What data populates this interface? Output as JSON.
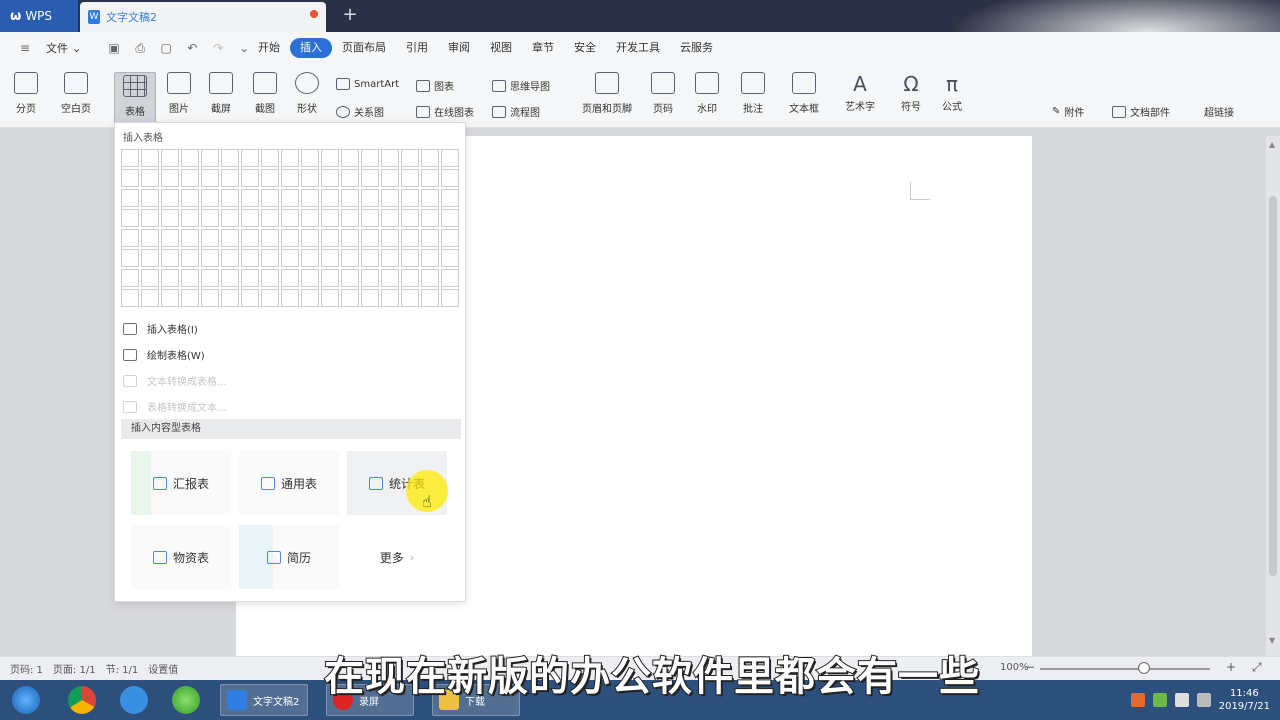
{
  "titlebar": {
    "app_name": "WPS",
    "doc_tab": "文字文稿2",
    "add_tab": "+"
  },
  "menubar": {
    "file_label": "文件",
    "items": [
      "开始",
      "插入",
      "页面布局",
      "引用",
      "审阅",
      "视图",
      "章节",
      "安全",
      "开发工具",
      "云服务"
    ],
    "active_index": 1
  },
  "ribbon": {
    "tools": [
      "分页",
      "空白页",
      "表格",
      "图片",
      "截屏",
      "截图",
      "形状",
      "页眉和页脚",
      "页码",
      "水印",
      "批注",
      "文本框",
      "艺术字",
      "符号",
      "公式",
      "文档部件",
      "超链接"
    ],
    "smartart": "SmartArt",
    "chart": "图表",
    "relation": "关系图",
    "online_chart": "在线图表",
    "mindmap": "思维导图",
    "flowchart": "流程图",
    "font_note": "附件",
    "active_tool": "表格"
  },
  "table_panel": {
    "title": "插入表格",
    "options": [
      {
        "label": "插入表格(I)",
        "enabled": true
      },
      {
        "label": "绘制表格(W)",
        "enabled": true
      },
      {
        "label": "文本转换成表格...",
        "enabled": false
      },
      {
        "label": "表格转换成文本...",
        "enabled": false
      }
    ],
    "section_title": "插入内容型表格",
    "templates": [
      "汇报表",
      "通用表",
      "统计表",
      "物资表",
      "简历"
    ],
    "more_label": "更多",
    "grid_cols": 17,
    "grid_rows": 8
  },
  "statusbar": {
    "items": [
      "页码: 1",
      "页面: 1/1",
      "节: 1/1",
      "设置值"
    ],
    "zoom": "100%",
    "zoom_fraction": 0.58
  },
  "taskbar": {
    "windows": [
      "文字文稿2",
      "录屏",
      "下载"
    ],
    "clock_time": "11:46",
    "clock_date": "2019/7/21"
  },
  "subtitle": "在现在新版的办公软件里都会有一些",
  "colors": {
    "accent": "#2c6fd6",
    "titlebar": "#2b3245",
    "taskbar": "#2d4f7c",
    "highlight": "#ffeb00"
  }
}
